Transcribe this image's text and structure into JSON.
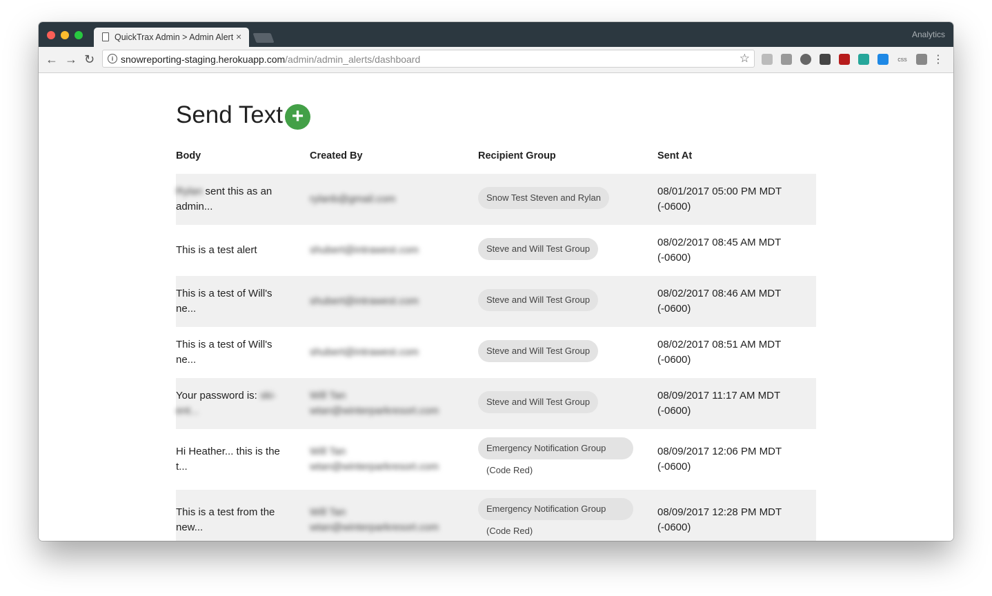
{
  "browser": {
    "tab_title": "QuickTrax Admin > Admin Alerts",
    "tab_close": "×",
    "profile": "Analytics",
    "url_host": "snowreporting-staging.herokuapp.com",
    "url_path": "/admin/admin_alerts/dashboard",
    "back": "←",
    "forward": "→",
    "reload": "↻",
    "star": "☆",
    "menu": "⋮"
  },
  "page": {
    "title": "Send Text",
    "add": "+"
  },
  "table": {
    "headers": [
      "Body",
      "Created By",
      "Recipient Group",
      "Sent At"
    ],
    "rows": [
      {
        "body_blur": "Rylan",
        "body": "sent this as an admin...",
        "created_by": "rylanb@gmail.com",
        "created_by_name": "",
        "group": "Snow Test Steven and Rylan",
        "group_sub": "",
        "sent_at": "08/01/2017 05:00 PM MDT (-0600)"
      },
      {
        "body_blur": "",
        "body": "This is a test alert",
        "created_by": "shubert@intrawest.com",
        "created_by_name": "",
        "group": "Steve and Will Test Group",
        "group_sub": "",
        "sent_at": "08/02/2017 08:45 AM MDT (-0600)"
      },
      {
        "body_blur": "",
        "body": "This is a test of Will's ne...",
        "created_by": "shubert@intrawest.com",
        "created_by_name": "",
        "group": "Steve and Will Test Group",
        "group_sub": "",
        "sent_at": "08/02/2017 08:46 AM MDT (-0600)"
      },
      {
        "body_blur": "",
        "body": "This is a test of Will's ne...",
        "created_by": "shubert@intrawest.com",
        "created_by_name": "",
        "group": "Steve and Will Test Group",
        "group_sub": "",
        "sent_at": "08/02/2017 08:51 AM MDT (-0600)"
      },
      {
        "body_blur": "ski-ent...",
        "body": "Your password is:",
        "created_by": "wtan@winterparkresort.com",
        "created_by_name": "Will Tan",
        "group": "Steve and Will Test Group",
        "group_sub": "",
        "sent_at": "08/09/2017 11:17 AM MDT (-0600)"
      },
      {
        "body_blur": "",
        "body": "Hi Heather... this is the t...",
        "created_by": "wtan@winterparkresort.com",
        "created_by_name": "Will Tan",
        "group": "Emergency Notification Group",
        "group_sub": "(Code Red)",
        "sent_at": "08/09/2017 12:06 PM MDT (-0600)"
      },
      {
        "body_blur": "",
        "body": "This is a test from the new...",
        "created_by": "wtan@winterparkresort.com",
        "created_by_name": "Will Tan",
        "group": "Emergency Notification Group",
        "group_sub": "(Code Red)",
        "sent_at": "08/09/2017 12:28 PM MDT (-0600)"
      }
    ]
  }
}
